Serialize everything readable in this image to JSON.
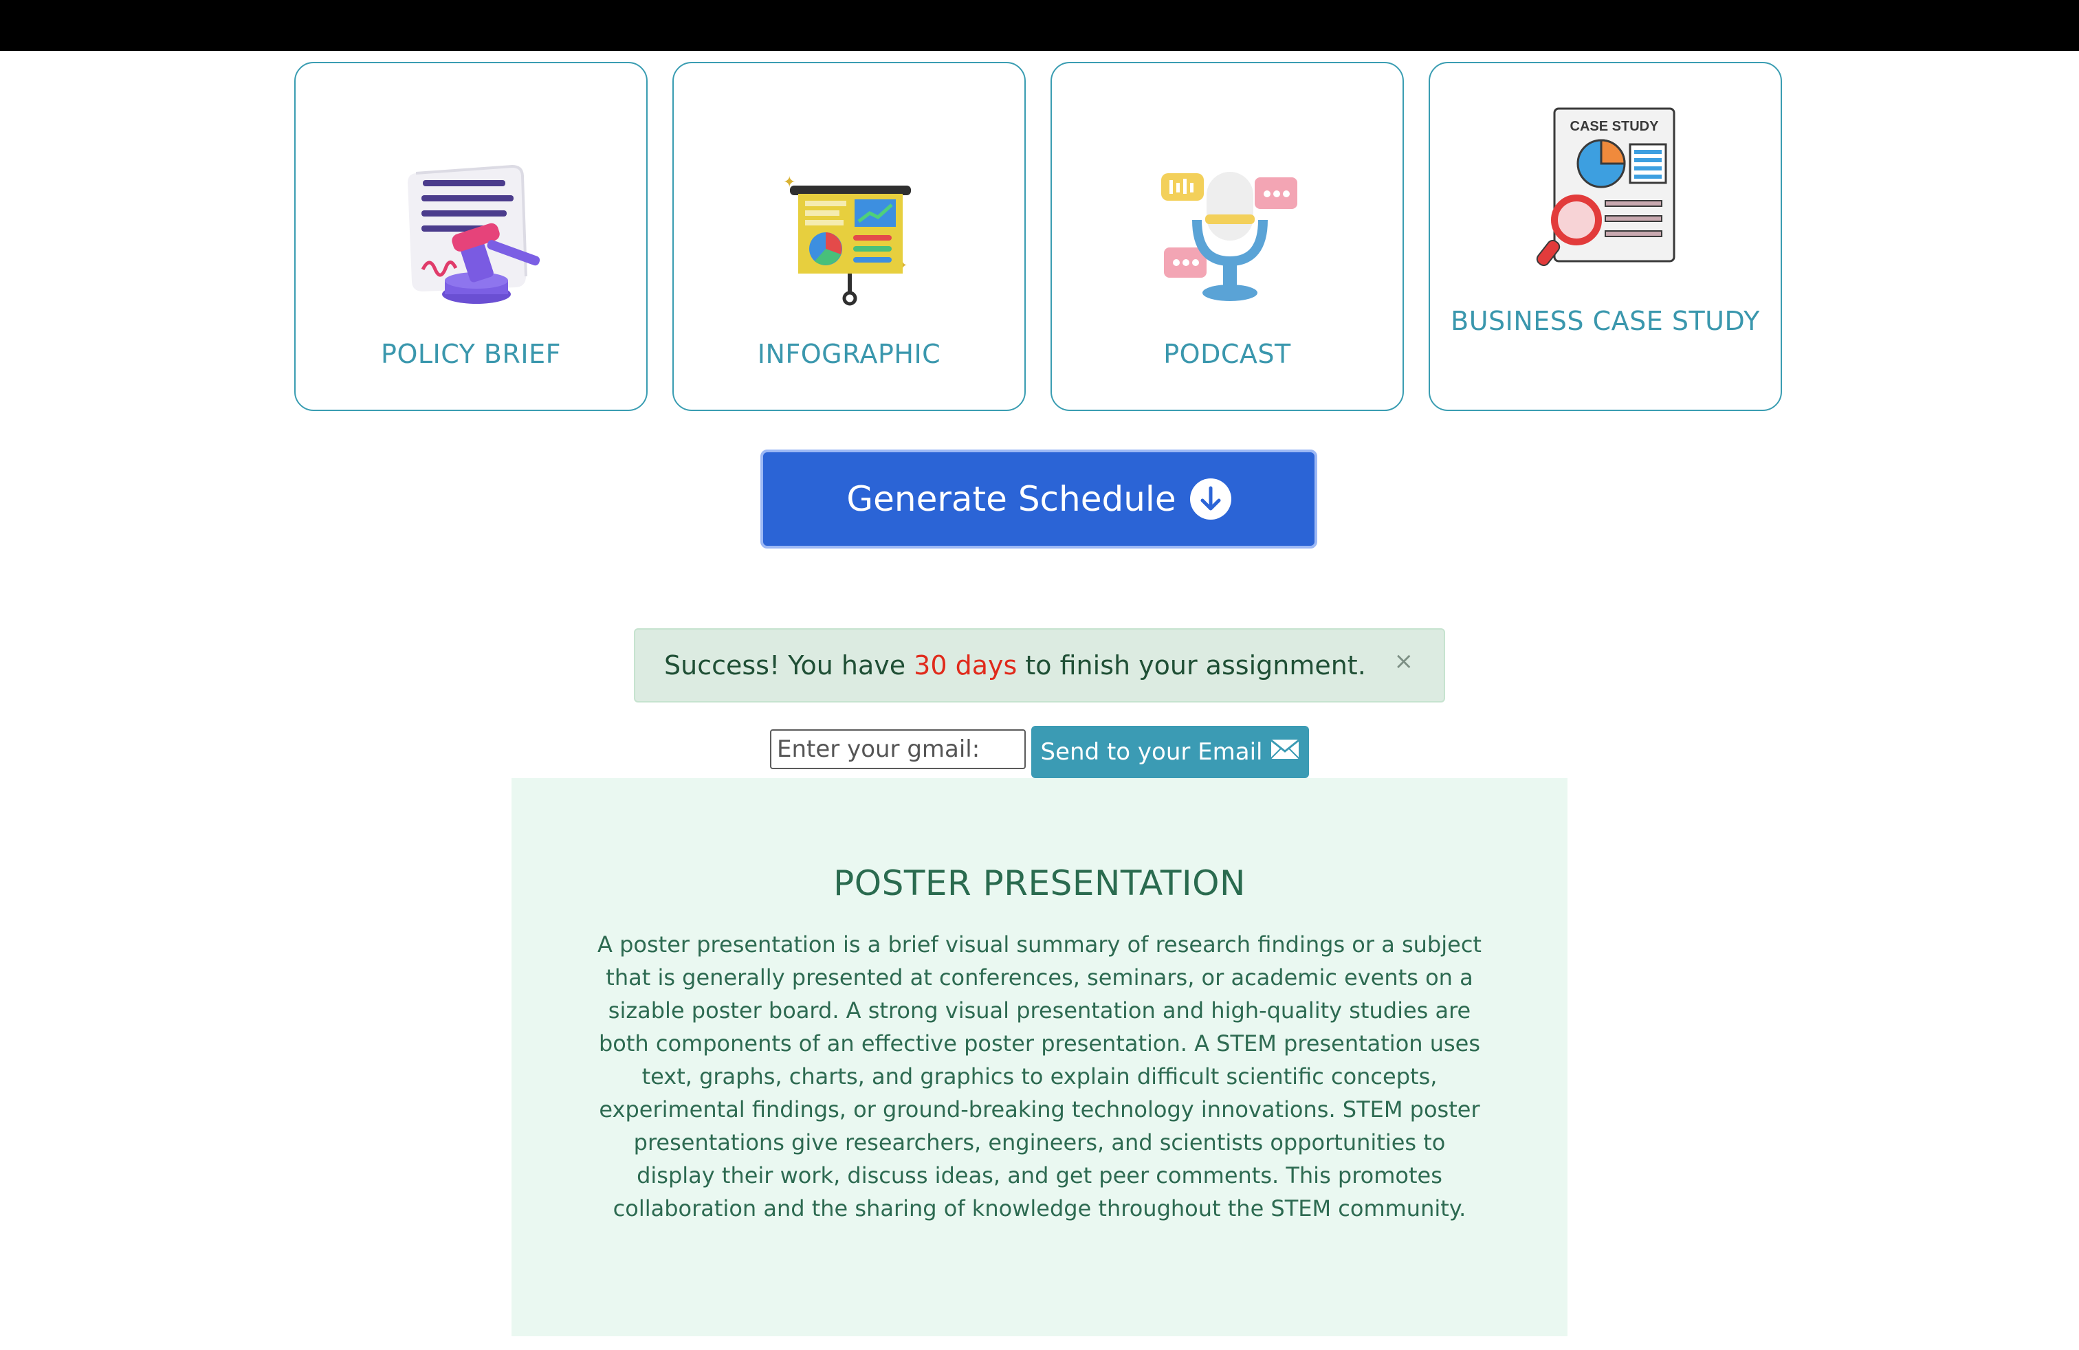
{
  "cards": [
    {
      "label": "POLICY BRIEF",
      "icon": "gavel-document-icon"
    },
    {
      "label": "INFOGRAPHIC",
      "icon": "presentation-board-icon"
    },
    {
      "label": "PODCAST",
      "icon": "microphone-icon"
    },
    {
      "label": "BUSINESS CASE STUDY",
      "icon": "case-study-icon",
      "icon_text": "CASE STUDY"
    }
  ],
  "generate_button": {
    "label": "Generate Schedule",
    "icon": "arrow-down-circle-icon"
  },
  "alert": {
    "prefix": "Success! You have ",
    "days": "30 days",
    "suffix": " to finish your assignment.",
    "close": "×"
  },
  "email": {
    "placeholder": "Enter your gmail:",
    "button_label": "Send to your Email",
    "button_icon": "envelope-icon"
  },
  "panel": {
    "title": "POSTER PRESENTATION",
    "body": "A poster presentation is a brief visual summary of research findings or a subject that is generally presented at conferences, seminars, or academic events on a sizable poster board. A strong visual presentation and high-quality studies are both components of an effective poster presentation. A STEM presentation uses text, graphs, charts, and graphics to explain difficult scientific concepts, experimental findings, or ground-breaking technology innovations. STEM poster presentations give researchers, engineers, and scientists opportunities to display their work, discuss ideas, and get peer comments. This promotes collaboration and the sharing of knowledge throughout the STEM community."
  },
  "colors": {
    "card_border": "#3a9db2",
    "card_label": "#3a97ad",
    "primary_button": "#2b64d6",
    "alert_bg": "#dcebe1",
    "alert_highlight": "#e02a1b",
    "send_button": "#3b9bb4",
    "panel_bg": "#eaf8f1"
  }
}
